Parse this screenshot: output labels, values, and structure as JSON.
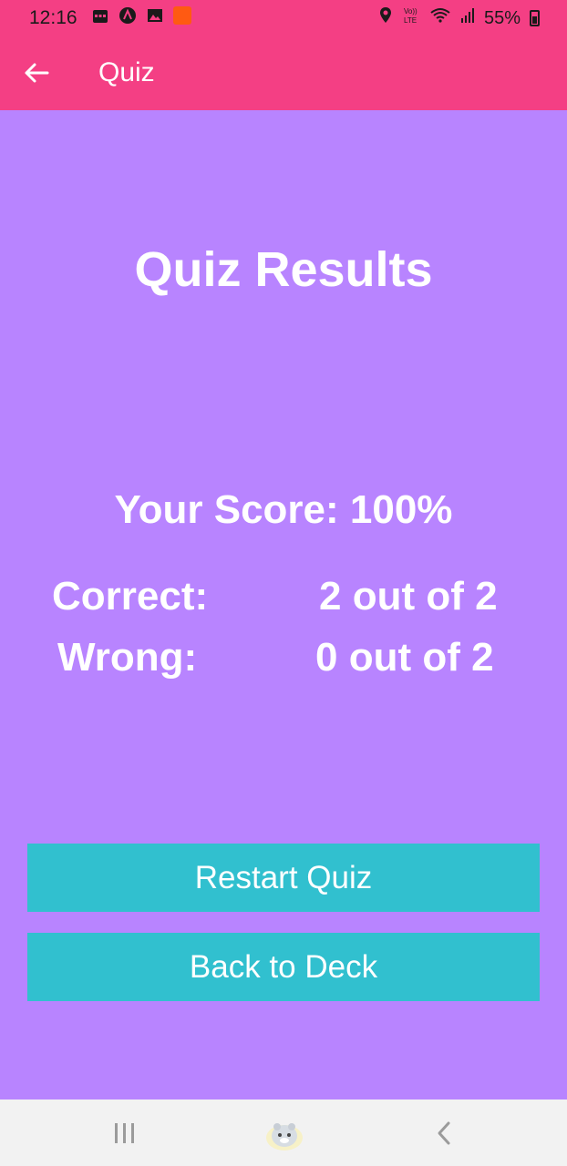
{
  "status_bar": {
    "time": "12:16",
    "battery": "55%",
    "icons": [
      "calendar-icon",
      "app-a-icon",
      "gallery-icon",
      "orange-app-icon",
      "location-icon",
      "volte-icon",
      "wifi-icon",
      "signal-icon",
      "battery-icon"
    ]
  },
  "appbar": {
    "title": "Quiz",
    "back_icon": "arrow-left-icon"
  },
  "results": {
    "title": "Quiz Results",
    "score": "Your Score: 100%",
    "correct_label": "Correct:",
    "correct_value": "2 out of 2",
    "wrong_label": "Wrong:",
    "wrong_value": "0 out of 2"
  },
  "buttons": {
    "restart": "Restart Quiz",
    "back_to_deck": "Back to Deck"
  },
  "nav": {
    "icons": [
      "recents-icon",
      "home-icon",
      "back-icon"
    ]
  },
  "colors": {
    "header": "#f43f84",
    "background": "#b884ff",
    "button": "#31c0cf",
    "navbar": "#f2f2f2"
  }
}
